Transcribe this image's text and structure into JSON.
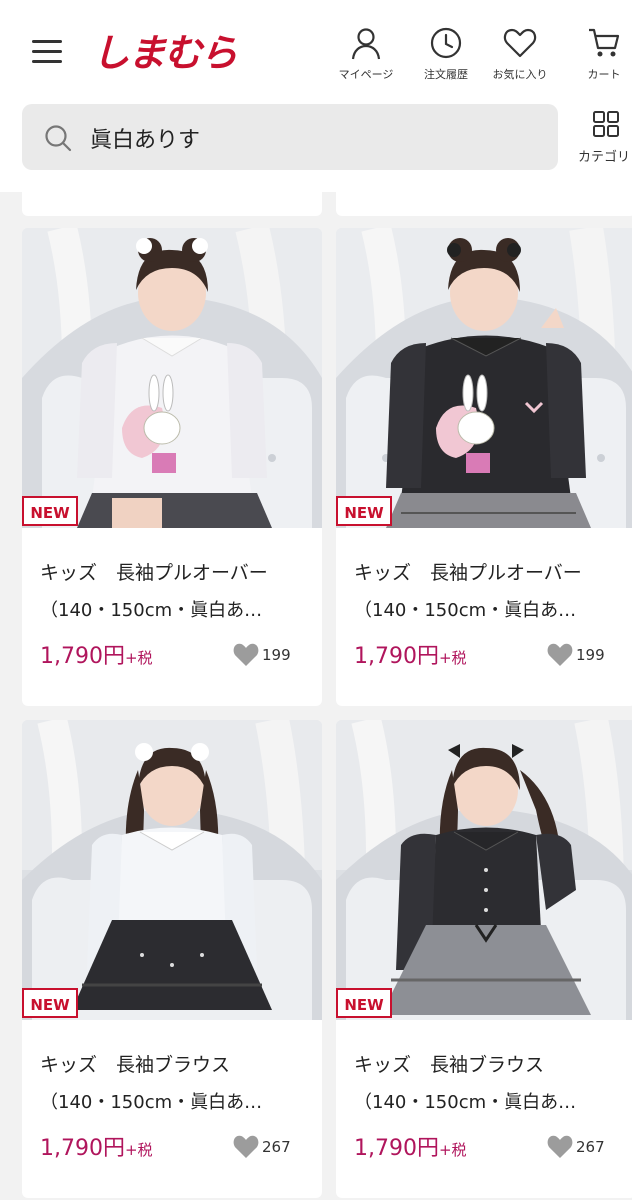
{
  "header": {
    "logo": "しまむら",
    "nav": [
      {
        "label": "マイページ",
        "icon": "person-icon"
      },
      {
        "label": "注文履歴",
        "icon": "clock-icon"
      },
      {
        "label": "お気に入り",
        "icon": "heart-icon"
      },
      {
        "label": "カート",
        "icon": "cart-icon"
      }
    ],
    "search": {
      "value": "眞白ありす"
    },
    "category_label": "カテゴリ"
  },
  "products": [
    {
      "badge": "NEW",
      "title": "キッズ　長袖プルオーバー",
      "subtitle": "（140・150cm・眞白あ…",
      "price": "1,790円",
      "tax": "+税",
      "favorites": "199"
    },
    {
      "badge": "NEW",
      "title": "キッズ　長袖プルオーバー",
      "subtitle": "（140・150cm・眞白あ…",
      "price": "1,790円",
      "tax": "+税",
      "favorites": "199"
    },
    {
      "badge": "NEW",
      "title": "キッズ　長袖ブラウス",
      "subtitle": "（140・150cm・眞白あ…",
      "price": "1,790円",
      "tax": "+税",
      "favorites": "267"
    },
    {
      "badge": "NEW",
      "title": "キッズ　長袖ブラウス",
      "subtitle": "（140・150cm・眞白あ…",
      "price": "1,790円",
      "tax": "+税",
      "favorites": "267"
    }
  ],
  "colors": {
    "brand": "#c8102e",
    "price": "#b0155c"
  }
}
